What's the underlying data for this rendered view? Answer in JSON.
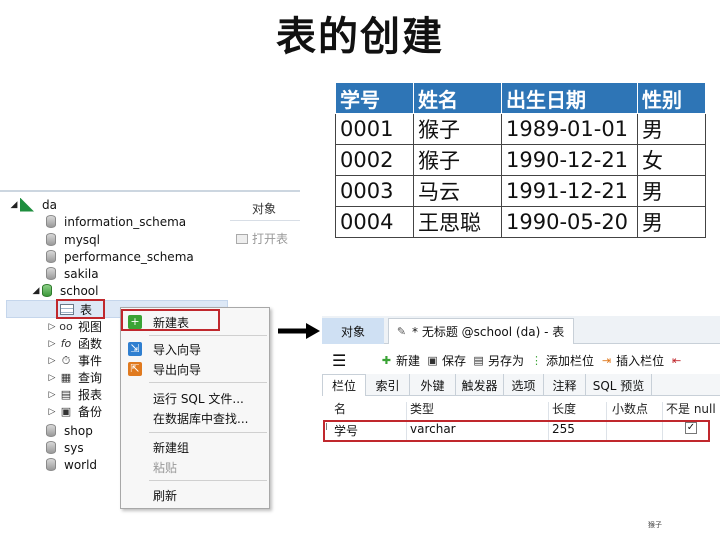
{
  "title": "表的创建",
  "student_table": {
    "headers": [
      "学号",
      "姓名",
      "出生日期",
      "性别"
    ],
    "rows": [
      [
        "0001",
        "猴子",
        "1989-01-01",
        "男"
      ],
      [
        "0002",
        "猴子",
        "1990-12-21",
        "女"
      ],
      [
        "0003",
        "马云",
        "1991-12-21",
        "男"
      ],
      [
        "0004",
        "王思聪",
        "1990-05-20",
        "男"
      ]
    ]
  },
  "navigator": {
    "connection": "da",
    "databases": [
      "information_schema",
      "mysql",
      "performance_schema",
      "sakila",
      "school"
    ],
    "school_children": [
      "表",
      "视图",
      "函数",
      "事件",
      "查询",
      "报表",
      "备份"
    ],
    "other_databases": [
      "shop",
      "sys",
      "world"
    ]
  },
  "side_panel": {
    "objects": "对象",
    "open_table": "打开表"
  },
  "context_menu": {
    "items": [
      "新建表",
      "导入向导",
      "导出向导",
      "运行 SQL 文件...",
      "在数据库中查找...",
      "新建组",
      "粘贴",
      "刷新"
    ]
  },
  "editor": {
    "tab_objects": "对象",
    "tab_new": "* 无标题 @school (da) - 表",
    "toolbar": [
      "新建",
      "保存",
      "另存为",
      "添加栏位",
      "插入栏位"
    ],
    "subtabs": [
      "栏位",
      "索引",
      "外键",
      "触发器",
      "选项",
      "注释",
      "SQL 预览"
    ],
    "columns": [
      "名",
      "类型",
      "长度",
      "小数点",
      "不是 null"
    ],
    "field": {
      "name": "学号",
      "type": "varchar",
      "length": "255",
      "decimals": "",
      "not_null": "✓"
    }
  },
  "footer_note": "猴子",
  "colors": {
    "header_blue": "#2e75b6",
    "highlight_red": "#c0282d",
    "selection": "#dde8f6"
  }
}
